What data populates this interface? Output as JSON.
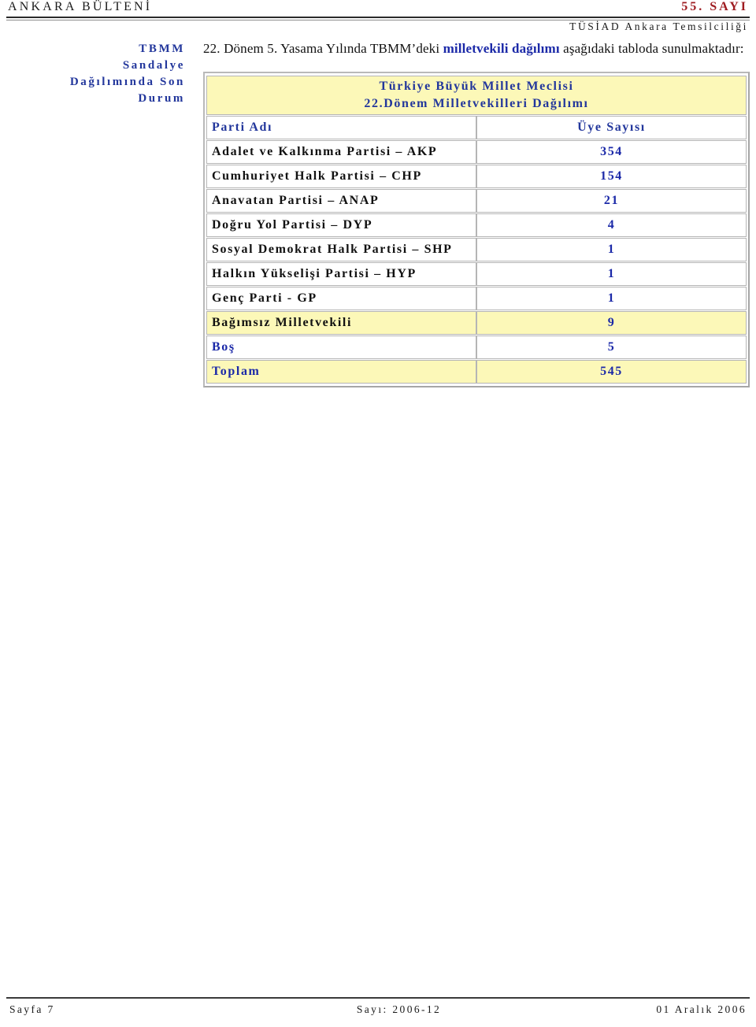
{
  "header": {
    "title": "ANKARA BÜLTENİ",
    "issue": "55. SAYI",
    "subtitle": "TÜSİAD Ankara Temsilciliği"
  },
  "sidebar": {
    "heading_lines": [
      "TBMM",
      "Sandalye",
      "Dağılımında Son",
      "Durum"
    ]
  },
  "main": {
    "intro_part1": "22. Dönem 5. Yasama Yılında TBMM’deki ",
    "intro_highlight": "milletvekili dağılımı",
    "intro_part2": " aşağıdaki tabloda sunulmaktadır:"
  },
  "table": {
    "title_line1": "Türkiye Büyük Millet Meclisi",
    "title_line2": "22.Dönem Milletvekilleri Dağılımı",
    "columns": [
      "Parti Adı",
      "Üye Sayısı"
    ],
    "rows": [
      {
        "name": "Adalet ve Kalkınma Partisi – AKP",
        "count": "354"
      },
      {
        "name": "Cumhuriyet Halk Partisi – CHP",
        "count": "154"
      },
      {
        "name": "Anavatan Partisi – ANAP",
        "count": "21"
      },
      {
        "name": "Doğru Yol Partisi – DYP",
        "count": "4"
      },
      {
        "name": "Sosyal Demokrat Halk Partisi – SHP",
        "count": "1"
      },
      {
        "name": "Halkın Yükselişi Partisi – HYP",
        "count": "1"
      },
      {
        "name": "Genç Parti - GP",
        "count": "1"
      },
      {
        "name": "Bağımsız Milletvekili",
        "count": "9"
      },
      {
        "name": "Boş",
        "count": "5"
      },
      {
        "name": "Toplam",
        "count": "545"
      }
    ]
  },
  "footer": {
    "page": "Sayfa 7",
    "issue": "Sayı: 2006-12",
    "date": "01 Aralık 2006"
  },
  "colors": {
    "accent_blue": "#23379c",
    "value_blue": "#1b29a8",
    "issue_red": "#9e1b20",
    "highlight_yellow": "#fcf8b8"
  }
}
